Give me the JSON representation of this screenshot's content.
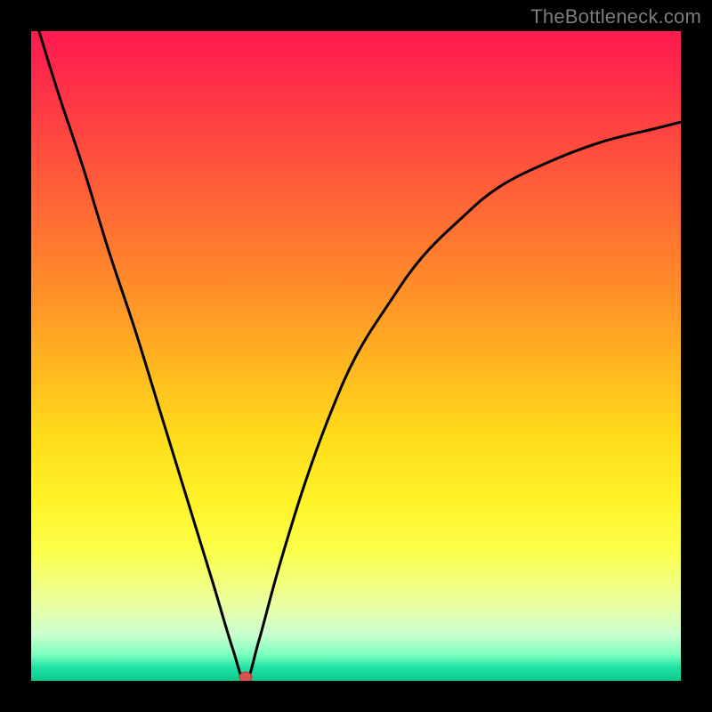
{
  "watermark": "TheBottleneck.com",
  "chart_data": {
    "type": "line",
    "title": "",
    "xlabel": "",
    "ylabel": "",
    "xlim": [
      0,
      100
    ],
    "ylim": [
      0,
      100
    ],
    "grid": false,
    "legend": false,
    "marker": {
      "x": 33,
      "y": 0,
      "color": "#d9534f"
    },
    "series": [
      {
        "name": "bottleneck-curve",
        "color": "#000000",
        "x": [
          0,
          4,
          8,
          12,
          16,
          20,
          24,
          28,
          31,
          33,
          35,
          38,
          42,
          46,
          50,
          55,
          60,
          66,
          72,
          80,
          88,
          96,
          100
        ],
        "y": [
          104,
          91,
          79,
          66,
          54,
          41,
          28,
          15,
          5,
          0,
          6,
          17,
          30,
          41,
          50,
          58,
          65,
          71,
          76,
          80,
          83,
          85,
          86
        ]
      }
    ],
    "gradient_stops": [
      {
        "pos": 0.0,
        "color": "#ff1a4f"
      },
      {
        "pos": 0.3,
        "color": "#ff6a34"
      },
      {
        "pos": 0.55,
        "color": "#ffc81e"
      },
      {
        "pos": 0.78,
        "color": "#fbff4a"
      },
      {
        "pos": 0.92,
        "color": "#d0ffc0"
      },
      {
        "pos": 1.0,
        "color": "#0cca8e"
      }
    ]
  }
}
